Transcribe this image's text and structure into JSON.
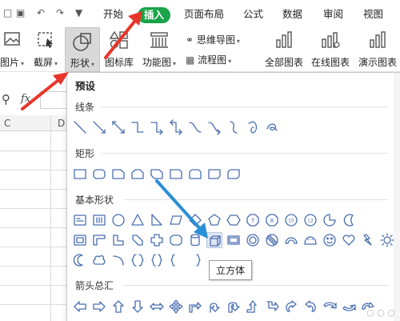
{
  "tabs": {
    "start": "开始",
    "insert": "插入",
    "layout": "页面布局",
    "formula": "公式",
    "data": "数据",
    "review": "审阅",
    "view": "视图"
  },
  "ribbon": {
    "picture_label": "图片",
    "screenshot_label": "截屏",
    "shapes_label": "形状",
    "icon_lib_label": "图标库",
    "function_chart_label": "功能图",
    "mindmap_label": "思维导图",
    "flowchart_label": "流程图",
    "all_charts_label": "全部图表",
    "online_charts_label": "在线图表",
    "demo_charts_label": "演示图表"
  },
  "formula_bar": {
    "fx": "fx"
  },
  "grid": {
    "col_c": "C",
    "col_d": "D"
  },
  "panel": {
    "title": "预设",
    "sections": {
      "lines": "线条",
      "rect": "矩形",
      "basic": "基本形状",
      "arrows": "箭头总汇"
    },
    "tooltip": "立方体"
  },
  "colors": {
    "accent_green": "#1aa34a",
    "shape_stroke": "#4a6fb0",
    "arrow_blue": "#2a8fd8",
    "arrow_red": "#e8352a"
  }
}
